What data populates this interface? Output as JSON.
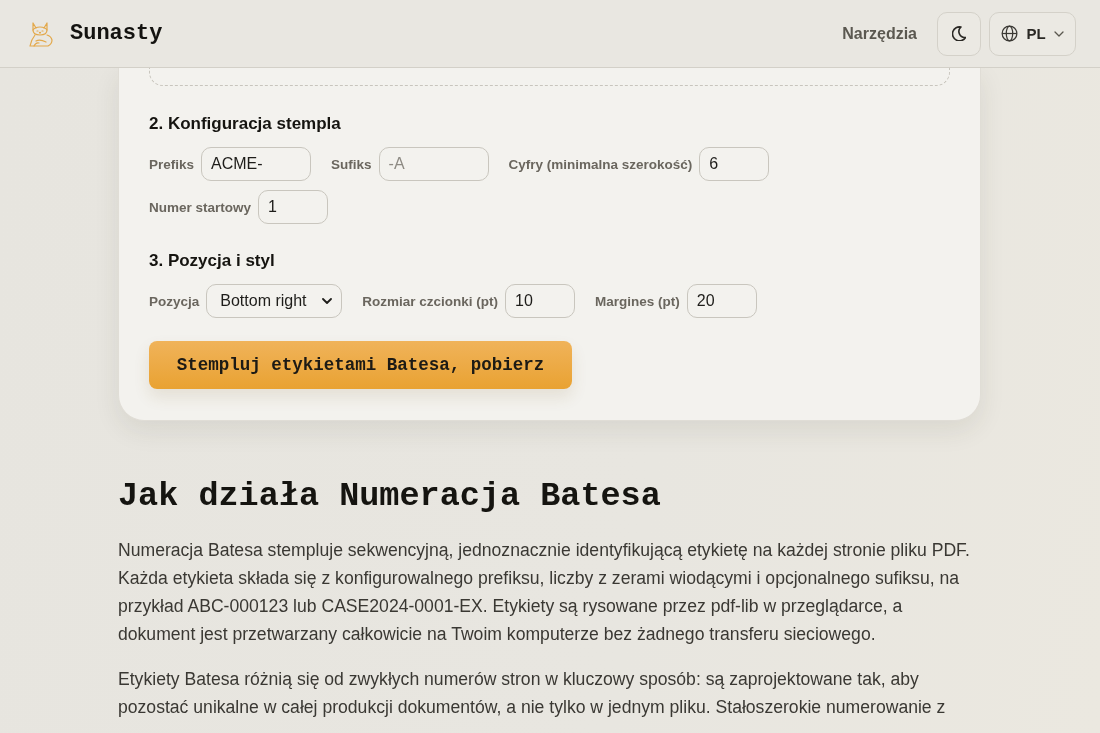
{
  "header": {
    "brand": "Sunasty",
    "nav_link": "Narzędzia",
    "language": "PL"
  },
  "stamp_form": {
    "sections": [
      {
        "heading": "2. Konfiguracja stempla",
        "fields": [
          {
            "kind": "text",
            "label": "Prefiks",
            "value": "ACME-"
          },
          {
            "kind": "text",
            "label": "Sufiks",
            "placeholder": "-A"
          },
          {
            "kind": "number",
            "label": "Cyfry (minimalna szerokość)",
            "value": "6"
          },
          {
            "kind": "number",
            "label": "Numer startowy",
            "value": "1"
          }
        ]
      },
      {
        "heading": "3. Pozycja i styl",
        "fields": [
          {
            "kind": "select",
            "label": "Pozycja",
            "value": "Bottom right"
          },
          {
            "kind": "number",
            "label": "Rozmiar czcionki (pt)",
            "value": "10"
          },
          {
            "kind": "number",
            "label": "Margines (pt)",
            "value": "20"
          }
        ]
      }
    ],
    "submit_button": "Stempluj etykietami Batesa, pobierz"
  },
  "article": {
    "heading": "Jak działa Numeracja Batesa",
    "paragraphs": [
      "Numeracja Batesa stempluje sekwencyjną, jednoznacznie identyfikującą etykietę na każdej stronie pliku PDF. Każda etykieta składa się z konfigurowalnego prefiksu, liczby z zerami wiodącymi i opcjonalnego sufiksu, na przykład ABC-000123 lub CASE2024-0001-EX. Etykiety są rysowane przez pdf-lib w przeglądarce, a dokument jest przetwarzany całkowicie na Twoim komputerze bez żadnego transferu sieciowego.",
      "Etykiety Batesa różnią się od zwykłych numerów stron w kluczowy sposób: są zaprojektowane tak, aby pozostać unikalne w całej produkcji dokumentów, a nie tylko w jednym pliku. Stałoszerokie numerowanie z"
    ]
  }
}
